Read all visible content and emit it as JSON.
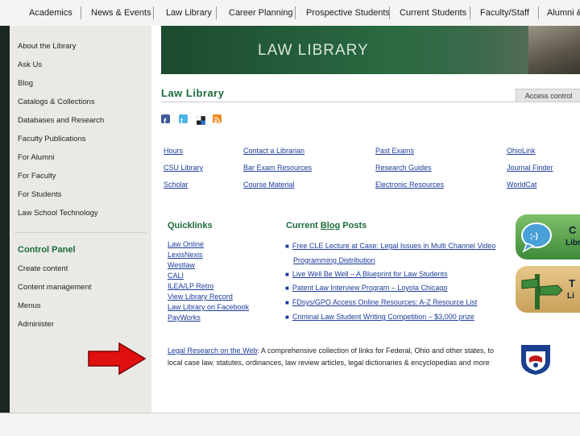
{
  "topnav": {
    "items": [
      "Academics",
      "News & Events",
      "Law Library",
      "Career Planning",
      "Prospective Students",
      "Current Students",
      "Faculty/Staff",
      "Alumni &"
    ]
  },
  "sidebar": {
    "items": [
      "About the Library",
      "Ask Us",
      "Blog",
      "Catalogs & Collections",
      "Databases and Research",
      "Faculty Publications",
      "For Alumni",
      "For Faculty",
      "For Students",
      "Law School Technology"
    ],
    "control_panel_title": "Control Panel",
    "control_items": [
      "Create content",
      "Content management",
      "Menus",
      "Administer"
    ]
  },
  "banner": {
    "title": "LAW LIBRARY"
  },
  "page": {
    "title": "Law Library",
    "access_tab": "Access control",
    "social_icons": [
      "facebook-icon",
      "twitter-icon",
      "delicious-icon",
      "rss-icon"
    ]
  },
  "links": {
    "col1": [
      "Hours",
      "CSU Library",
      "Scholar"
    ],
    "col2": [
      "Contact a Librarian",
      "Bar Exam Resources",
      "Course Material"
    ],
    "col3": [
      "Past Exams",
      "Research Guides",
      "Electronic Resources"
    ],
    "col4": [
      "OhioLink",
      "Journal Finder",
      "WorldCat"
    ]
  },
  "quicklinks": {
    "title": "Quicklinks",
    "items": [
      "Law Online",
      "LexisNexis",
      "Westlaw",
      "CALI",
      "ILEA/LP Retro",
      "View Library Record",
      "Law Library on Facebook",
      "PayWorks"
    ]
  },
  "blog": {
    "title_prefix": "Current ",
    "title_link": "Blog",
    "title_suffix": " Posts",
    "posts": [
      "Free CLE Lecture at Case: Legal Issues in Multi Channel Video",
      "Programming Distribution",
      "Live Well Be Well – A Blueprint for Law Students",
      "Patent Law Interview Program – Loyola Chicago",
      "FDsys/GPO Access Online Resources: A-Z Resource List",
      "Criminal Law Student Writing Competition – $3,000 prize"
    ]
  },
  "legal": {
    "link": "Legal Research on the Web",
    "text": ": A comprehensive collection of links for Federal, Ohio and other states, to local case law, statutes, ordinances, law review articles, legal dictionaries & encyclopedias and more"
  },
  "side_buttons": [
    {
      "label": "C",
      "sub": "Libr"
    },
    {
      "label": "T",
      "sub": "Li"
    }
  ],
  "colors": {
    "accent_green": "#1d6b3b",
    "link_blue": "#1a3a9a",
    "arrow_red": "#e01010"
  }
}
